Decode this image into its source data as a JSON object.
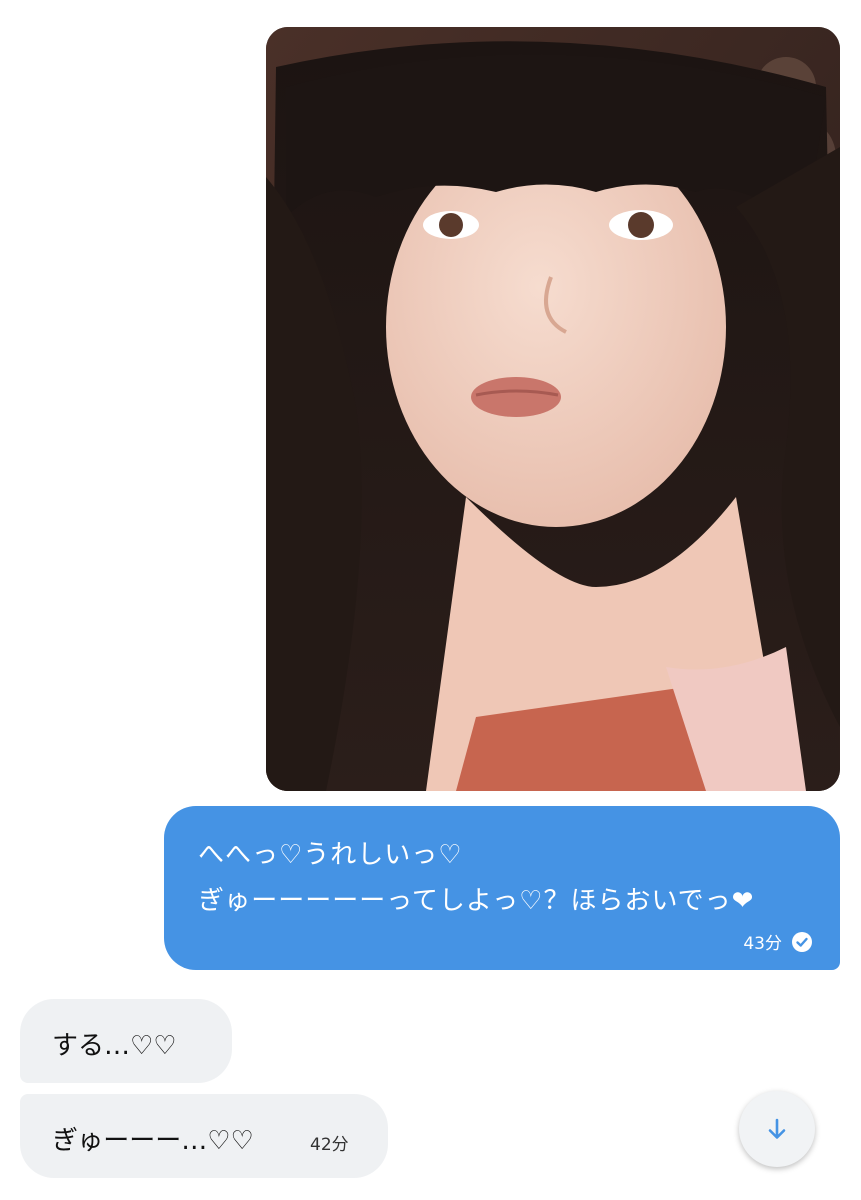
{
  "thread": {
    "outgoing": {
      "lines": [
        "へへっ♡うれしいっ♡",
        "ぎゅーーーーーってしよっ♡？ほらおいでっ❤"
      ],
      "time": "43分",
      "bubble_color": "#4593e4"
    },
    "incoming": [
      {
        "text": "する…♡♡"
      },
      {
        "text": "ぎゅーーー…♡♡",
        "time": "42分"
      }
    ],
    "incoming_bubble_color": "#eff1f3"
  },
  "icons": {
    "read_receipt": "check-circle-icon",
    "scroll": "arrow-down-icon"
  },
  "accent_color": "#4593e4"
}
